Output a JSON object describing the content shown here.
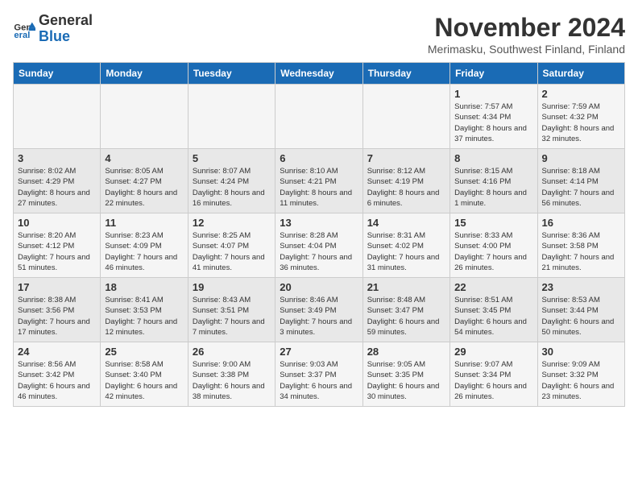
{
  "logo": {
    "line1": "General",
    "line2": "Blue"
  },
  "title": "November 2024",
  "location": "Merimasku, Southwest Finland, Finland",
  "weekdays": [
    "Sunday",
    "Monday",
    "Tuesday",
    "Wednesday",
    "Thursday",
    "Friday",
    "Saturday"
  ],
  "weeks": [
    [
      {
        "day": "",
        "info": ""
      },
      {
        "day": "",
        "info": ""
      },
      {
        "day": "",
        "info": ""
      },
      {
        "day": "",
        "info": ""
      },
      {
        "day": "",
        "info": ""
      },
      {
        "day": "1",
        "info": "Sunrise: 7:57 AM\nSunset: 4:34 PM\nDaylight: 8 hours and 37 minutes."
      },
      {
        "day": "2",
        "info": "Sunrise: 7:59 AM\nSunset: 4:32 PM\nDaylight: 8 hours and 32 minutes."
      }
    ],
    [
      {
        "day": "3",
        "info": "Sunrise: 8:02 AM\nSunset: 4:29 PM\nDaylight: 8 hours and 27 minutes."
      },
      {
        "day": "4",
        "info": "Sunrise: 8:05 AM\nSunset: 4:27 PM\nDaylight: 8 hours and 22 minutes."
      },
      {
        "day": "5",
        "info": "Sunrise: 8:07 AM\nSunset: 4:24 PM\nDaylight: 8 hours and 16 minutes."
      },
      {
        "day": "6",
        "info": "Sunrise: 8:10 AM\nSunset: 4:21 PM\nDaylight: 8 hours and 11 minutes."
      },
      {
        "day": "7",
        "info": "Sunrise: 8:12 AM\nSunset: 4:19 PM\nDaylight: 8 hours and 6 minutes."
      },
      {
        "day": "8",
        "info": "Sunrise: 8:15 AM\nSunset: 4:16 PM\nDaylight: 8 hours and 1 minute."
      },
      {
        "day": "9",
        "info": "Sunrise: 8:18 AM\nSunset: 4:14 PM\nDaylight: 7 hours and 56 minutes."
      }
    ],
    [
      {
        "day": "10",
        "info": "Sunrise: 8:20 AM\nSunset: 4:12 PM\nDaylight: 7 hours and 51 minutes."
      },
      {
        "day": "11",
        "info": "Sunrise: 8:23 AM\nSunset: 4:09 PM\nDaylight: 7 hours and 46 minutes."
      },
      {
        "day": "12",
        "info": "Sunrise: 8:25 AM\nSunset: 4:07 PM\nDaylight: 7 hours and 41 minutes."
      },
      {
        "day": "13",
        "info": "Sunrise: 8:28 AM\nSunset: 4:04 PM\nDaylight: 7 hours and 36 minutes."
      },
      {
        "day": "14",
        "info": "Sunrise: 8:31 AM\nSunset: 4:02 PM\nDaylight: 7 hours and 31 minutes."
      },
      {
        "day": "15",
        "info": "Sunrise: 8:33 AM\nSunset: 4:00 PM\nDaylight: 7 hours and 26 minutes."
      },
      {
        "day": "16",
        "info": "Sunrise: 8:36 AM\nSunset: 3:58 PM\nDaylight: 7 hours and 21 minutes."
      }
    ],
    [
      {
        "day": "17",
        "info": "Sunrise: 8:38 AM\nSunset: 3:56 PM\nDaylight: 7 hours and 17 minutes."
      },
      {
        "day": "18",
        "info": "Sunrise: 8:41 AM\nSunset: 3:53 PM\nDaylight: 7 hours and 12 minutes."
      },
      {
        "day": "19",
        "info": "Sunrise: 8:43 AM\nSunset: 3:51 PM\nDaylight: 7 hours and 7 minutes."
      },
      {
        "day": "20",
        "info": "Sunrise: 8:46 AM\nSunset: 3:49 PM\nDaylight: 7 hours and 3 minutes."
      },
      {
        "day": "21",
        "info": "Sunrise: 8:48 AM\nSunset: 3:47 PM\nDaylight: 6 hours and 59 minutes."
      },
      {
        "day": "22",
        "info": "Sunrise: 8:51 AM\nSunset: 3:45 PM\nDaylight: 6 hours and 54 minutes."
      },
      {
        "day": "23",
        "info": "Sunrise: 8:53 AM\nSunset: 3:44 PM\nDaylight: 6 hours and 50 minutes."
      }
    ],
    [
      {
        "day": "24",
        "info": "Sunrise: 8:56 AM\nSunset: 3:42 PM\nDaylight: 6 hours and 46 minutes."
      },
      {
        "day": "25",
        "info": "Sunrise: 8:58 AM\nSunset: 3:40 PM\nDaylight: 6 hours and 42 minutes."
      },
      {
        "day": "26",
        "info": "Sunrise: 9:00 AM\nSunset: 3:38 PM\nDaylight: 6 hours and 38 minutes."
      },
      {
        "day": "27",
        "info": "Sunrise: 9:03 AM\nSunset: 3:37 PM\nDaylight: 6 hours and 34 minutes."
      },
      {
        "day": "28",
        "info": "Sunrise: 9:05 AM\nSunset: 3:35 PM\nDaylight: 6 hours and 30 minutes."
      },
      {
        "day": "29",
        "info": "Sunrise: 9:07 AM\nSunset: 3:34 PM\nDaylight: 6 hours and 26 minutes."
      },
      {
        "day": "30",
        "info": "Sunrise: 9:09 AM\nSunset: 3:32 PM\nDaylight: 6 hours and 23 minutes."
      }
    ]
  ]
}
